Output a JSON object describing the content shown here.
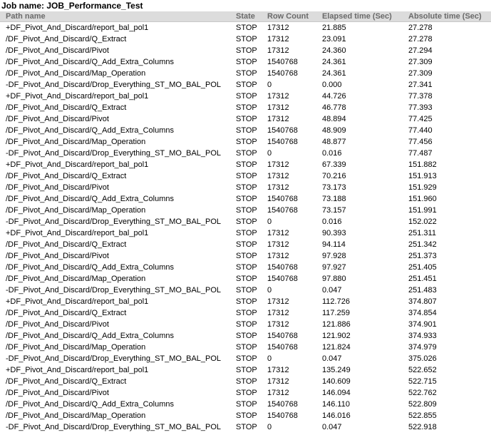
{
  "job": {
    "title": "Job name: JOB_Performance_Test"
  },
  "table": {
    "columns": [
      "Path name",
      "State",
      "Row Count",
      "Elapsed time (Sec)",
      "Absolute time (Sec)"
    ],
    "rows": [
      [
        "+DF_Pivot_And_Discard/report_bal_pol1",
        "STOP",
        "17312",
        "21.885",
        "27.278"
      ],
      [
        "/DF_Pivot_And_Discard/Q_Extract",
        "STOP",
        "17312",
        "23.091",
        "27.278"
      ],
      [
        "/DF_Pivot_And_Discard/Pivot",
        "STOP",
        "17312",
        "24.360",
        "27.294"
      ],
      [
        "/DF_Pivot_And_Discard/Q_Add_Extra_Columns",
        "STOP",
        "1540768",
        "24.361",
        "27.309"
      ],
      [
        "/DF_Pivot_And_Discard/Map_Operation",
        "STOP",
        "1540768",
        "24.361",
        "27.309"
      ],
      [
        "-DF_Pivot_And_Discard/Drop_Everything_ST_MO_BAL_POL",
        "STOP",
        "0",
        "0.000",
        "27.341"
      ],
      [
        "+DF_Pivot_And_Discard/report_bal_pol1",
        "STOP",
        "17312",
        "44.726",
        "77.378"
      ],
      [
        "/DF_Pivot_And_Discard/Q_Extract",
        "STOP",
        "17312",
        "46.778",
        "77.393"
      ],
      [
        "/DF_Pivot_And_Discard/Pivot",
        "STOP",
        "17312",
        "48.894",
        "77.425"
      ],
      [
        "/DF_Pivot_And_Discard/Q_Add_Extra_Columns",
        "STOP",
        "1540768",
        "48.909",
        "77.440"
      ],
      [
        "/DF_Pivot_And_Discard/Map_Operation",
        "STOP",
        "1540768",
        "48.877",
        "77.456"
      ],
      [
        "-DF_Pivot_And_Discard/Drop_Everything_ST_MO_BAL_POL",
        "STOP",
        "0",
        "0.016",
        "77.487"
      ],
      [
        "+DF_Pivot_And_Discard/report_bal_pol1",
        "STOP",
        "17312",
        "67.339",
        "151.882"
      ],
      [
        "/DF_Pivot_And_Discard/Q_Extract",
        "STOP",
        "17312",
        "70.216",
        "151.913"
      ],
      [
        "/DF_Pivot_And_Discard/Pivot",
        "STOP",
        "17312",
        "73.173",
        "151.929"
      ],
      [
        "/DF_Pivot_And_Discard/Q_Add_Extra_Columns",
        "STOP",
        "1540768",
        "73.188",
        "151.960"
      ],
      [
        "/DF_Pivot_And_Discard/Map_Operation",
        "STOP",
        "1540768",
        "73.157",
        "151.991"
      ],
      [
        "-DF_Pivot_And_Discard/Drop_Everything_ST_MO_BAL_POL",
        "STOP",
        "0",
        "0.016",
        "152.022"
      ],
      [
        "+DF_Pivot_And_Discard/report_bal_pol1",
        "STOP",
        "17312",
        "90.393",
        "251.311"
      ],
      [
        "/DF_Pivot_And_Discard/Q_Extract",
        "STOP",
        "17312",
        "94.114",
        "251.342"
      ],
      [
        "/DF_Pivot_And_Discard/Pivot",
        "STOP",
        "17312",
        "97.928",
        "251.373"
      ],
      [
        "/DF_Pivot_And_Discard/Q_Add_Extra_Columns",
        "STOP",
        "1540768",
        "97.927",
        "251.405"
      ],
      [
        "/DF_Pivot_And_Discard/Map_Operation",
        "STOP",
        "1540768",
        "97.880",
        "251.451"
      ],
      [
        "-DF_Pivot_And_Discard/Drop_Everything_ST_MO_BAL_POL",
        "STOP",
        "0",
        "0.047",
        "251.483"
      ],
      [
        "+DF_Pivot_And_Discard/report_bal_pol1",
        "STOP",
        "17312",
        "112.726",
        "374.807"
      ],
      [
        "/DF_Pivot_And_Discard/Q_Extract",
        "STOP",
        "17312",
        "117.259",
        "374.854"
      ],
      [
        "/DF_Pivot_And_Discard/Pivot",
        "STOP",
        "17312",
        "121.886",
        "374.901"
      ],
      [
        "/DF_Pivot_And_Discard/Q_Add_Extra_Columns",
        "STOP",
        "1540768",
        "121.902",
        "374.933"
      ],
      [
        "/DF_Pivot_And_Discard/Map_Operation",
        "STOP",
        "1540768",
        "121.824",
        "374.979"
      ],
      [
        "-DF_Pivot_And_Discard/Drop_Everything_ST_MO_BAL_POL",
        "STOP",
        "0",
        "0.047",
        "375.026"
      ],
      [
        "+DF_Pivot_And_Discard/report_bal_pol1",
        "STOP",
        "17312",
        "135.249",
        "522.652"
      ],
      [
        "/DF_Pivot_And_Discard/Q_Extract",
        "STOP",
        "17312",
        "140.609",
        "522.715"
      ],
      [
        "/DF_Pivot_And_Discard/Pivot",
        "STOP",
        "17312",
        "146.094",
        "522.762"
      ],
      [
        "/DF_Pivot_And_Discard/Q_Add_Extra_Columns",
        "STOP",
        "1540768",
        "146.110",
        "522.809"
      ],
      [
        "/DF_Pivot_And_Discard/Map_Operation",
        "STOP",
        "1540768",
        "146.016",
        "522.855"
      ],
      [
        "-DF_Pivot_And_Discard/Drop_Everything_ST_MO_BAL_POL",
        "STOP",
        "0",
        "0.047",
        "522.918"
      ]
    ]
  }
}
